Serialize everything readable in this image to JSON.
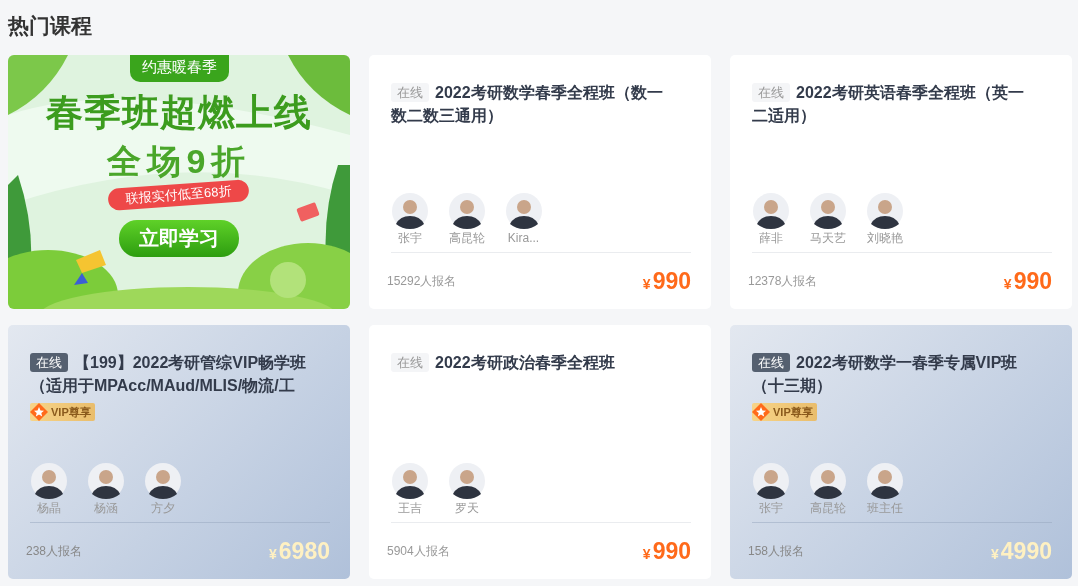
{
  "section_title": "热门课程",
  "banner": {
    "tag": "约惠暖春季",
    "headline": "春季班超燃上线",
    "offer": "全场9折",
    "ribbon": "联报实付低至68折",
    "button": "立即学习"
  },
  "courses": [
    {
      "kind": "standard",
      "tag": "在线",
      "title": "2022考研数学春季全程班（数一数二数三通用）",
      "teachers": [
        "张宇",
        "高昆轮",
        "Kira..."
      ],
      "enrolled": "15292人报名",
      "currency": "¥",
      "price": "990"
    },
    {
      "kind": "standard",
      "tag": "在线",
      "title": "2022考研英语春季全程班（英一二适用）",
      "teachers": [
        "薛非",
        "马天艺",
        "刘晓艳"
      ],
      "enrolled": "12378人报名",
      "currency": "¥",
      "price": "990"
    },
    {
      "kind": "vip",
      "tag": "在线",
      "title": "【199】2022考研管综VIP畅学班（适用于MPAcc/MAud/MLIS/物流/工",
      "vip_badge": "VIP尊享",
      "teachers": [
        "杨晶",
        "杨涵",
        "方夕"
      ],
      "enrolled": "238人报名",
      "currency": "¥",
      "price": "6980"
    },
    {
      "kind": "standard",
      "tag": "在线",
      "title": "2022考研政治春季全程班",
      "teachers": [
        "王吉",
        "罗天"
      ],
      "enrolled": "5904人报名",
      "currency": "¥",
      "price": "990"
    },
    {
      "kind": "vip",
      "tag": "在线",
      "title": "2022考研数学一春季专属VIP班（十三期）",
      "vip_badge": "VIP尊享",
      "teachers": [
        "张宇",
        "高昆轮",
        "班主任"
      ],
      "enrolled": "158人报名",
      "currency": "¥",
      "price": "4990"
    }
  ]
}
